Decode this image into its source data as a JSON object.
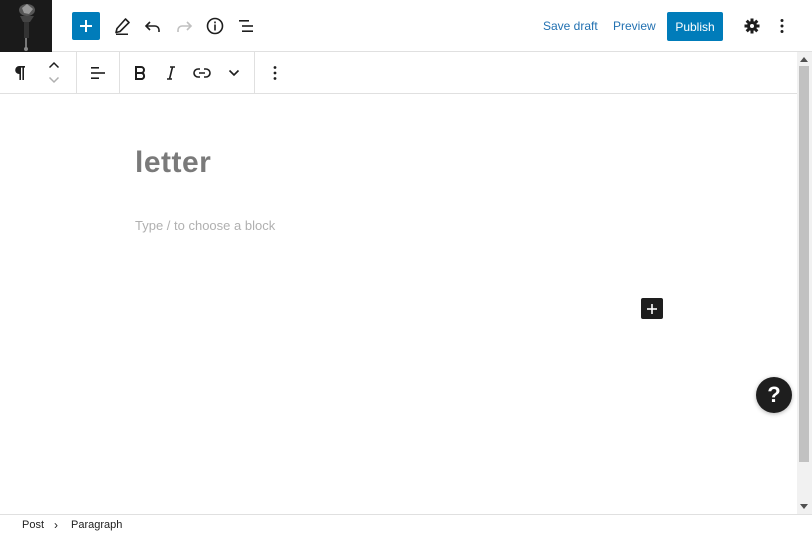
{
  "header": {
    "save_draft_label": "Save draft",
    "preview_label": "Preview",
    "publish_label": "Publish"
  },
  "editor": {
    "title": "letter",
    "placeholder": "Type / to choose a block"
  },
  "help": {
    "label": "?"
  },
  "breadcrumb": {
    "items": [
      "Post",
      "Paragraph"
    ],
    "separator": "›"
  },
  "colors": {
    "accent": "#007cba",
    "dark": "#1e1e1e"
  },
  "icons": {
    "inserter": "plus-icon",
    "tools": "pencil-icon",
    "undo": "undo-icon",
    "redo": "redo-icon",
    "details": "info-icon",
    "outline": "list-view-icon",
    "settings": "gear-icon",
    "options": "vertical-ellipsis-icon",
    "block_type": "pilcrow-icon",
    "move": "chevron-up-down-icon",
    "align": "align-left-icon",
    "bold": "bold-icon",
    "italic": "italic-icon",
    "link": "link-icon",
    "more_formatting": "chevron-down-icon",
    "block_options": "vertical-ellipsis-icon",
    "help": "help-icon"
  }
}
